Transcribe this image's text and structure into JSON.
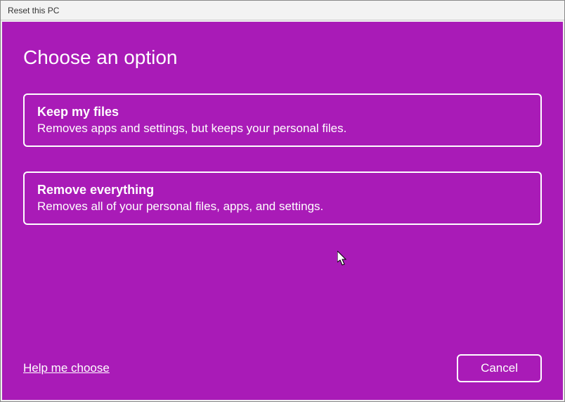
{
  "window": {
    "title": "Reset this PC"
  },
  "heading": "Choose an option",
  "options": [
    {
      "title": "Keep my files",
      "description": "Removes apps and settings, but keeps your personal files."
    },
    {
      "title": "Remove everything",
      "description": "Removes all of your personal files, apps, and settings."
    }
  ],
  "footer": {
    "help_link": "Help me choose",
    "cancel_label": "Cancel"
  }
}
